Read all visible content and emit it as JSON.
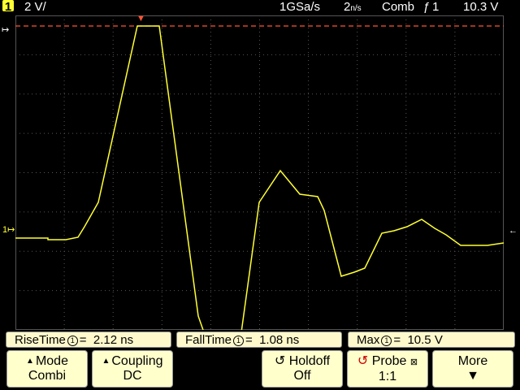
{
  "status": {
    "channel": "1",
    "vdiv": "2 V/",
    "sample_rate": "1GSa/s",
    "timebase": "2",
    "timebase_unit": "n/s",
    "mode": "Comb",
    "trigger_source": "1",
    "trigger_level": "10.3  V"
  },
  "measurements": {
    "rise": {
      "label": "RiseTime",
      "src": "1",
      "value": "2.12 ns"
    },
    "fall": {
      "label": "FallTime",
      "src": "1",
      "value": "1.08 ns"
    },
    "max": {
      "label": "Max",
      "src": "1",
      "value": "10.5  V"
    }
  },
  "softkeys": {
    "mode": {
      "title": "Mode",
      "value": "Combi"
    },
    "coupling": {
      "title": "Coupling",
      "value": "DC"
    },
    "holdoff": {
      "title": "Holdoff",
      "value": "Off"
    },
    "probe": {
      "title": "Probe",
      "value": "1:1"
    },
    "more": {
      "title": "More"
    }
  },
  "colors": {
    "trace": "#ffff33",
    "trigger_line": "#ff5533",
    "grid": "#555555",
    "softkey_bg": "#ffffcc"
  },
  "icons": [
    "channel-badge-icon",
    "trigger-edge-icon",
    "holdoff-icon",
    "probe-icon",
    "down-arrow-icon"
  ]
}
